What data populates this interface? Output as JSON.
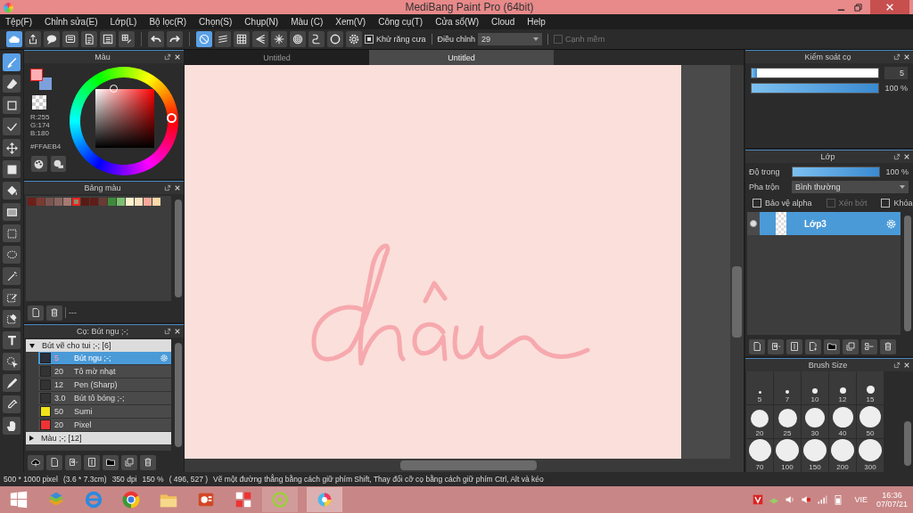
{
  "window": {
    "title": "MediBang Paint Pro (64bit)"
  },
  "menu": [
    "Tệp(F)",
    "Chỉnh sửa(E)",
    "Lớp(L)",
    "Bộ lọc(R)",
    "Chọn(S)",
    "Chụp(N)",
    "Màu (C)",
    "Xem(V)",
    "Công cụ(T)",
    "Cửa sổ(W)",
    "Cloud",
    "Help"
  ],
  "toolbar": {
    "buttons": [
      {
        "kind": "cloud",
        "selected": true
      },
      {
        "kind": "share",
        "selected": false
      },
      {
        "kind": "comment",
        "selected": false
      },
      {
        "kind": "chat",
        "selected": false
      },
      {
        "kind": "document",
        "selected": false
      },
      {
        "kind": "list",
        "selected": false
      },
      {
        "kind": "gridedit",
        "selected": false
      },
      {
        "kind": "undo",
        "selected": false
      },
      {
        "kind": "redo",
        "selected": false
      },
      {
        "kind": "nosnap",
        "selected": true
      },
      {
        "kind": "parallel",
        "selected": false
      },
      {
        "kind": "grid",
        "selected": false
      },
      {
        "kind": "perspective",
        "selected": false
      },
      {
        "kind": "radial",
        "selected": false
      },
      {
        "kind": "concentric",
        "selected": false
      },
      {
        "kind": "curve",
        "selected": false
      },
      {
        "kind": "circle",
        "selected": false
      },
      {
        "kind": "gear",
        "selected": false
      }
    ],
    "antialias": {
      "label": "Khử răng cưa",
      "checked": true
    },
    "correction": {
      "label": "Điều chỉnh",
      "value": "29"
    },
    "soft_edge": {
      "label": "Cạnh mềm",
      "checked": false,
      "disabled": true
    }
  },
  "tools": [
    {
      "kind": "brush",
      "selected": true
    },
    {
      "kind": "eraser",
      "selected": false
    },
    {
      "kind": "rect",
      "selected": false
    },
    {
      "kind": "polyline",
      "selected": false
    },
    {
      "kind": "move",
      "selected": false
    },
    {
      "kind": "fillrect",
      "selected": false
    },
    {
      "kind": "bucket",
      "selected": false
    },
    {
      "kind": "gradient",
      "selected": false
    },
    {
      "kind": "selrect",
      "selected": false
    },
    {
      "kind": "lasso",
      "selected": false
    },
    {
      "kind": "wand",
      "selected": false
    },
    {
      "kind": "selpen",
      "selected": false
    },
    {
      "kind": "seleraser",
      "selected": false
    },
    {
      "kind": "text",
      "selected": false
    },
    {
      "kind": "pointer",
      "selected": false
    },
    {
      "kind": "pen",
      "selected": false
    },
    {
      "kind": "eyedropper",
      "selected": false
    },
    {
      "kind": "hand",
      "selected": false
    }
  ],
  "color_panel": {
    "title": "Màu",
    "r": "R:255",
    "g": "G:174",
    "b": "B:180",
    "hex": "#FFAEB4"
  },
  "palette": {
    "title": "Bảng màu",
    "footer": "---",
    "swatches": [
      {
        "color": "#6e1f17",
        "selected": false
      },
      {
        "color": "#7c3a30",
        "selected": false
      },
      {
        "color": "#7a5450",
        "selected": false
      },
      {
        "color": "#8a6560",
        "selected": false
      },
      {
        "color": "#a57a72",
        "selected": false
      },
      {
        "color": "#8f8a6a",
        "selected": true
      },
      {
        "color": "#5a1a14",
        "selected": false
      },
      {
        "color": "#5e1d18",
        "selected": false
      },
      {
        "color": "#6a3a35",
        "selected": false
      },
      {
        "color": "#3e8a3a",
        "selected": false
      },
      {
        "color": "#7cbf70",
        "selected": false
      },
      {
        "color": "#fff1cc",
        "selected": false
      },
      {
        "color": "#ffe2bf",
        "selected": false
      },
      {
        "color": "#f7a89a",
        "selected": false
      },
      {
        "color": "#fcd9a8",
        "selected": false
      }
    ]
  },
  "brushes": {
    "title": "Cọ: Bút ngu ;-;",
    "groups": [
      {
        "label": "Bút vẽ cho tui ;-; [6]",
        "expanded": true,
        "items": [
          {
            "size": "5",
            "name": "Bút ngu ;-;",
            "color": "#2a2f3a",
            "selected": true
          },
          {
            "size": "20",
            "name": "Tô mờ nhạt",
            "color": "#333333",
            "selected": false
          },
          {
            "size": "12",
            "name": "Pen (Sharp)",
            "color": "#333333",
            "selected": false
          },
          {
            "size": "3.0",
            "name": "Bút tô bóng ;-;",
            "color": "#333333",
            "selected": false
          },
          {
            "size": "50",
            "name": "Sumi",
            "color": "#f2e21a",
            "selected": false
          },
          {
            "size": "20",
            "name": "Pixel",
            "color": "#ee3333",
            "selected": false
          }
        ]
      },
      {
        "label": "Màu ;-; [12]",
        "expanded": false
      }
    ]
  },
  "canvas_tabs": [
    {
      "label": "Untitled",
      "selected": false
    },
    {
      "label": "Untitled",
      "selected": true
    }
  ],
  "brush_control": {
    "title": "Kiểm soát cọ",
    "size_slider": {
      "level": 0.04
    },
    "size": "5",
    "opacity_slider": {
      "level": 1
    },
    "opacity": "100 %"
  },
  "layers": {
    "title": "Lớp",
    "opacity_label": "Độ trong",
    "opacity_slider": {
      "level": 1
    },
    "opacity": "100 %",
    "blend_label": "Pha trộn",
    "blend": "Bình thường",
    "options": [
      {
        "label": "Bảo vệ alpha",
        "checked": false,
        "disabled": false
      },
      {
        "label": "Xén bớt",
        "checked": false,
        "disabled": true
      },
      {
        "label": "Khóa",
        "checked": false,
        "disabled": false
      }
    ],
    "items": [
      {
        "name": "Lớp3",
        "selected": true,
        "visible": true
      }
    ]
  },
  "brush_size": {
    "title": "Brush Size",
    "sizes": [
      "5",
      "7",
      "10",
      "12",
      "15",
      "20",
      "25",
      "30",
      "40",
      "50",
      "70",
      "100",
      "150",
      "200",
      "300"
    ]
  },
  "status": [
    "500 * 1000 pixel",
    "(3.6 * 7.3cm)",
    "350 dpi",
    "150 %",
    "( 496, 527 )",
    "Vẽ một đường thẳng bằng cách giữ phím Shift, Thay đổi cỡ cọ bằng cách giữ phím Ctrl, Alt và kéo"
  ],
  "taskbar": {
    "language": "VIE",
    "time": "16:36",
    "date": "07/07/21"
  }
}
